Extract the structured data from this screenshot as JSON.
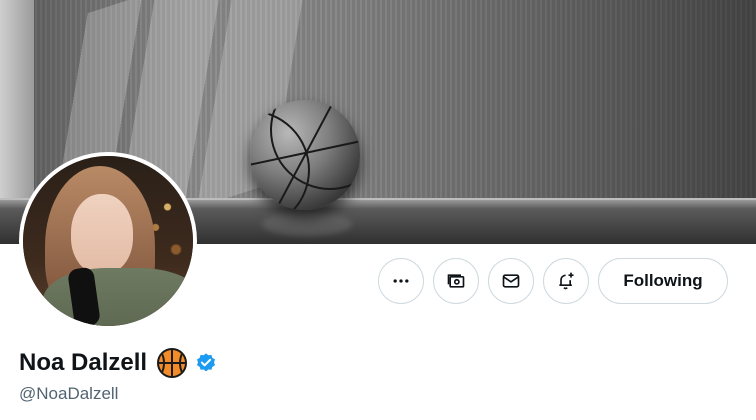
{
  "profile": {
    "display_name": "Noa Dalzell",
    "handle": "@NoaDalzell",
    "name_emoji": "basketball-emoji",
    "verified_badge": "verified-icon",
    "verified_color": "#1d9bf0"
  },
  "actions": {
    "more_icon": "more-horizontal-icon",
    "subscribe_icon": "monetization-icon",
    "message_icon": "mail-icon",
    "notify_icon": "bell-plus-icon",
    "following_label": "Following"
  },
  "colors": {
    "text_primary": "#0f1419",
    "text_secondary": "#536471",
    "button_border": "#cfd9de"
  }
}
